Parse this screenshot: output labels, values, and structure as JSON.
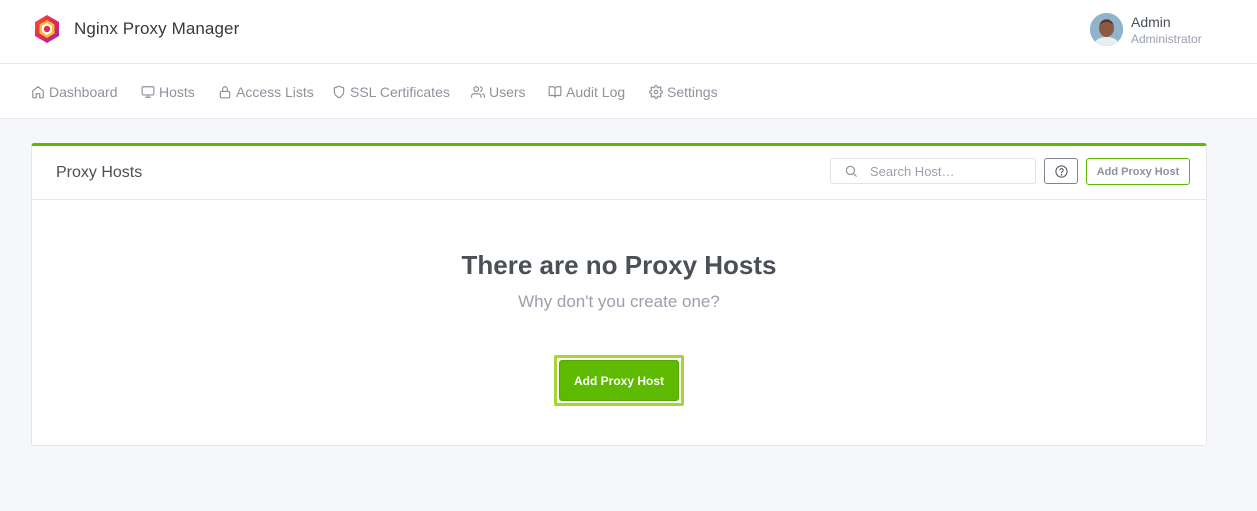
{
  "app": {
    "title": "Nginx Proxy Manager"
  },
  "user": {
    "name": "Admin",
    "role": "Administrator"
  },
  "nav": {
    "items": [
      {
        "label": "Dashboard",
        "icon": "home-icon"
      },
      {
        "label": "Hosts",
        "icon": "monitor-icon"
      },
      {
        "label": "Access Lists",
        "icon": "lock-icon"
      },
      {
        "label": "SSL Certificates",
        "icon": "shield-icon"
      },
      {
        "label": "Users",
        "icon": "users-icon"
      },
      {
        "label": "Audit Log",
        "icon": "book-open-icon"
      },
      {
        "label": "Settings",
        "icon": "settings-icon"
      }
    ]
  },
  "card": {
    "title": "Proxy Hosts",
    "search_placeholder": "Search Host…",
    "add_button_label": "Add Proxy Host",
    "empty_title": "There are no Proxy Hosts",
    "empty_subtitle": "Why don't you create one?",
    "empty_button_label": "Add Proxy Host"
  },
  "colors": {
    "accent": "#5eba00",
    "focus_ring": "#a6d632",
    "background": "#f5f7fb"
  }
}
